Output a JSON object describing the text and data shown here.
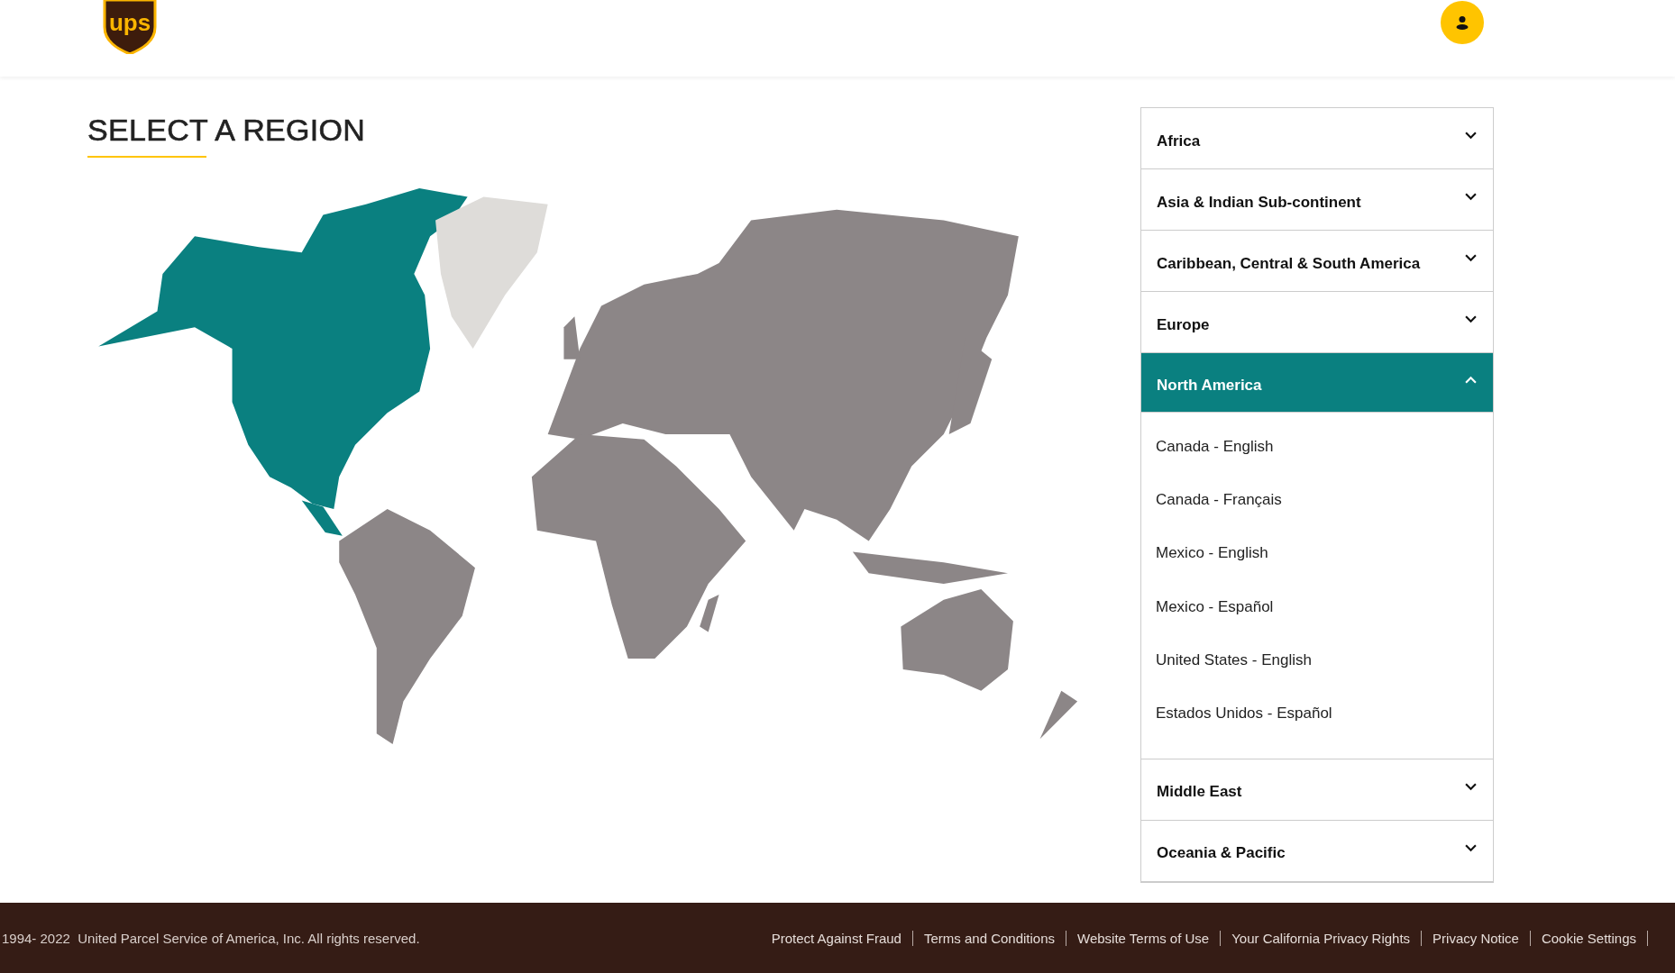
{
  "header": {
    "logo_text": "ups"
  },
  "page": {
    "title": "SELECT A REGION"
  },
  "regions": [
    {
      "label": "Africa",
      "expanded": false
    },
    {
      "label": "Asia & Indian Sub-continent",
      "expanded": false
    },
    {
      "label": "Caribbean, Central & South America",
      "expanded": false
    },
    {
      "label": "Europe",
      "expanded": false
    },
    {
      "label": "North America",
      "expanded": true,
      "items": [
        "Canada - English",
        "Canada - Français",
        "Mexico - English",
        "Mexico - Español",
        "United States - English",
        "Estados Unidos - Español"
      ]
    },
    {
      "label": "Middle East",
      "expanded": false
    },
    {
      "label": "Oceania & Pacific",
      "expanded": false
    }
  ],
  "footer": {
    "copyright": "1994- 2022  United Parcel Service of America, Inc. All rights reserved.",
    "links": [
      "Protect Against Fraud",
      "Terms and Conditions",
      "Website Terms of Use",
      "Your California Privacy Rights",
      "Privacy Notice",
      "Cookie Settings"
    ]
  }
}
